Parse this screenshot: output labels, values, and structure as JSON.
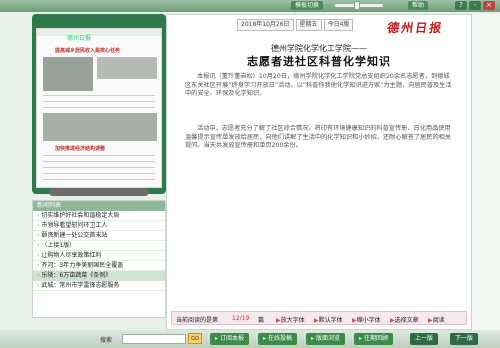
{
  "topbar": {
    "btn_guide": "模板切换",
    "btn_help": "帮助",
    "win_controls": [
      "?",
      "-",
      "×"
    ]
  },
  "left": {
    "thumb_header": "德州日报",
    "thumb_headline": "提高城乡居民收入是核心任务",
    "thumb_headline2": "加快推进经济结构调整"
  },
  "newslist": {
    "title": "新闻列表",
    "items": [
      "切实维护好社会和谐稳定大局",
      "市领导看望慰问环卫工人",
      "颐贤新建一处公交首末站",
      "（上接1版）",
      "让购物人尽享政策红利",
      "齐河：3年力争美丽国民全覆盖",
      "乐陵：6万亩蔬菜《条例》",
      "武城：常州市学雷锋志愿服务"
    ],
    "highlight_index": 6
  },
  "main": {
    "date": "2018年10月26日",
    "weekday": "星期五",
    "edition": "今日4版",
    "logo": "德州日报",
    "subhead": "德州学院化学化工学院——",
    "headline": "志愿者进社区科普化学知识",
    "paragraphs": [
      "本报讯（董玲董岩松）10月20日，德州学院化学化工学院党总支组织20余名志愿者，到德城区东关社区开展“终身学习开放日”活动。以“科普你我他化学知识进万家”为主题，向居民普及生活中的安全、环保及化学知识。",
      "活动中，志愿者充分了解了社区综合情况，将印有环境健康知识的科普宣传册、日化用品使用温馨提示宣传单发放给居民，向他们讲解了生活中的化学知识和小妙招，还耐心解答了居民的相关提问。当天共发放宣传册和单页200余份。"
    ],
    "reading_status": "当前阅读的是第",
    "reading_page": "12/19",
    "reading_page_suffix": "篇",
    "font_big": "放大字体",
    "font_default": "默认字体",
    "font_small": "缩小字体",
    "choose": "选择文章",
    "read": "阅读"
  },
  "foot": {
    "search_label": "搜索",
    "go": "GO",
    "order": "订阅本报",
    "online": "在线投稿",
    "layout": "版面浏览",
    "history": "往期回顾",
    "prev": "上一版",
    "next": "下一版"
  }
}
